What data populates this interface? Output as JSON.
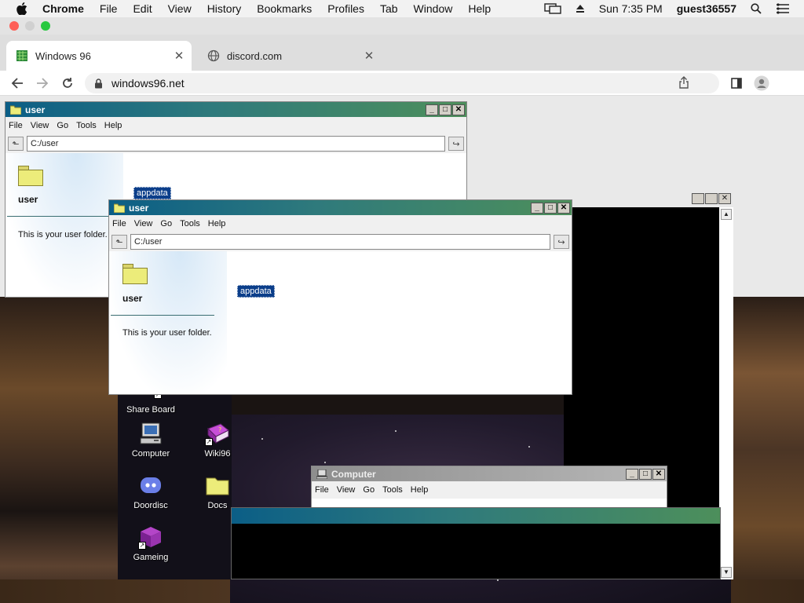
{
  "menubar": {
    "app": "Chrome",
    "items": [
      "File",
      "Edit",
      "View",
      "History",
      "Bookmarks",
      "Profiles",
      "Tab",
      "Window",
      "Help"
    ],
    "clock": "Sun 7:35 PM",
    "user": "guest36557"
  },
  "tabs": [
    {
      "title": "Windows 96",
      "active": true
    },
    {
      "title": "discord.com",
      "active": false
    }
  ],
  "address": {
    "url": "windows96.net"
  },
  "explorer_back": {
    "title": "user",
    "menu": [
      "File",
      "View",
      "Go",
      "Tools",
      "Help"
    ],
    "path": "C:/user",
    "folder_name": "user",
    "description": "This is your user folder.",
    "selected_item": "appdata"
  },
  "explorer_front": {
    "title": "user",
    "menu": [
      "File",
      "View",
      "Go",
      "Tools",
      "Help"
    ],
    "path": "C:/user",
    "folder_name": "user",
    "description": "This is your user folder.",
    "selected_item": "appdata"
  },
  "computer_window": {
    "title": "Computer",
    "menu": [
      "File",
      "View",
      "Go",
      "Tools",
      "Help"
    ]
  },
  "desktop_icons": [
    {
      "label": "Share Board"
    },
    {
      "label": "Computer"
    },
    {
      "label": "Wiki96"
    },
    {
      "label": "Doordisc"
    },
    {
      "label": "Docs"
    },
    {
      "label": "Gameing"
    }
  ],
  "colors": {
    "title_active": "#0b5e86",
    "title_active_end": "#4d8f5b",
    "selection": "#0b3e8a",
    "folder_yellow": "#ecec7a"
  }
}
